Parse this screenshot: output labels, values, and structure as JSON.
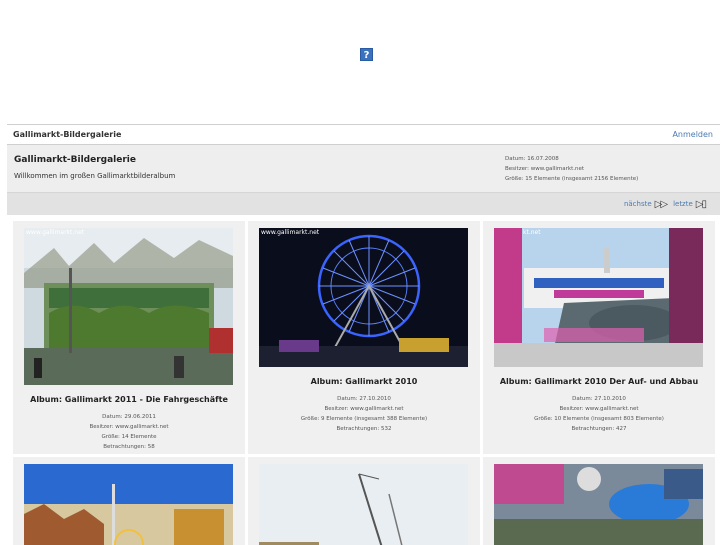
{
  "banner": {
    "icon": "help-icon",
    "glyph": "?"
  },
  "header": {
    "title": "Gallimarkt-Bildergalerie",
    "login": "Anmelden"
  },
  "album": {
    "title": "Gallimarkt-Bildergalerie",
    "description": "Willkommen im großen Gallimarktbilderalbum",
    "meta": [
      "Datum: 16.07.2008",
      "Besitzer: www.gallimarkt.net",
      "Größe: 15 Elemente (insgesamt 2156 Elemente)"
    ]
  },
  "nav": {
    "next": "nächste",
    "last": "letzte"
  },
  "cards": [
    {
      "title": "Album: Gallimarkt 2011 - Die Fahrgeschäfte",
      "meta": [
        "Datum: 29.06.2011",
        "Besitzer: www.gallimarkt.net",
        "Größe: 14 Elemente",
        "Betrachtungen: 58"
      ],
      "watermark": "www.gallimarkt.net"
    },
    {
      "title": "Album: Gallimarkt 2010",
      "meta": [
        "Datum: 27.10.2010",
        "Besitzer: www.gallimarkt.net",
        "Größe: 9 Elemente (insgesamt 388 Elemente)",
        "Betrachtungen: 532"
      ],
      "watermark": "www.gallimarkt.net"
    },
    {
      "title": "Album: Gallimarkt 2010 Der Auf- und Abbau",
      "meta": [
        "Datum: 27.10.2010",
        "Besitzer: www.gallimarkt.net",
        "Größe: 10 Elemente (insgesamt 803 Elemente)",
        "Betrachtungen: 427"
      ],
      "watermark": "kt.net"
    }
  ]
}
